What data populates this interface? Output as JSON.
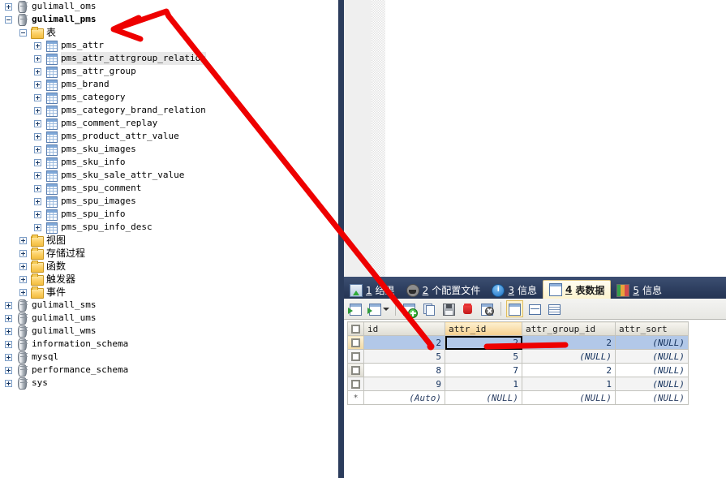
{
  "tree": {
    "items": [
      {
        "label": "gulimall_oms",
        "indent": 0,
        "icon": "database-icon",
        "expander": "plus",
        "bold": false
      },
      {
        "label": "gulimall_pms",
        "indent": 0,
        "icon": "database-icon",
        "expander": "minus",
        "bold": true
      },
      {
        "label": "表",
        "indent": 1,
        "icon": "folder-icon",
        "expander": "minus",
        "bold": false,
        "cjk": true
      },
      {
        "label": "pms_attr",
        "indent": 2,
        "icon": "table-icon",
        "expander": "plus",
        "bold": false
      },
      {
        "label": "pms_attr_attrgroup_relation",
        "indent": 2,
        "icon": "table-icon",
        "expander": "plus",
        "bold": false,
        "highlight": true
      },
      {
        "label": "pms_attr_group",
        "indent": 2,
        "icon": "table-icon",
        "expander": "plus",
        "bold": false
      },
      {
        "label": "pms_brand",
        "indent": 2,
        "icon": "table-icon",
        "expander": "plus",
        "bold": false
      },
      {
        "label": "pms_category",
        "indent": 2,
        "icon": "table-icon",
        "expander": "plus",
        "bold": false
      },
      {
        "label": "pms_category_brand_relation",
        "indent": 2,
        "icon": "table-icon",
        "expander": "plus",
        "bold": false
      },
      {
        "label": "pms_comment_replay",
        "indent": 2,
        "icon": "table-icon",
        "expander": "plus",
        "bold": false
      },
      {
        "label": "pms_product_attr_value",
        "indent": 2,
        "icon": "table-icon",
        "expander": "plus",
        "bold": false
      },
      {
        "label": "pms_sku_images",
        "indent": 2,
        "icon": "table-icon",
        "expander": "plus",
        "bold": false
      },
      {
        "label": "pms_sku_info",
        "indent": 2,
        "icon": "table-icon",
        "expander": "plus",
        "bold": false
      },
      {
        "label": "pms_sku_sale_attr_value",
        "indent": 2,
        "icon": "table-icon",
        "expander": "plus",
        "bold": false
      },
      {
        "label": "pms_spu_comment",
        "indent": 2,
        "icon": "table-icon",
        "expander": "plus",
        "bold": false
      },
      {
        "label": "pms_spu_images",
        "indent": 2,
        "icon": "table-icon",
        "expander": "plus",
        "bold": false
      },
      {
        "label": "pms_spu_info",
        "indent": 2,
        "icon": "table-icon",
        "expander": "plus",
        "bold": false
      },
      {
        "label": "pms_spu_info_desc",
        "indent": 2,
        "icon": "table-icon",
        "expander": "plus",
        "bold": false
      },
      {
        "label": "视图",
        "indent": 1,
        "icon": "folder-icon",
        "expander": "plus",
        "bold": false,
        "cjk": true
      },
      {
        "label": "存储过程",
        "indent": 1,
        "icon": "folder-icon",
        "expander": "plus",
        "bold": false,
        "cjk": true
      },
      {
        "label": "函数",
        "indent": 1,
        "icon": "folder-icon",
        "expander": "plus",
        "bold": false,
        "cjk": true
      },
      {
        "label": "触发器",
        "indent": 1,
        "icon": "folder-icon",
        "expander": "plus",
        "bold": false,
        "cjk": true
      },
      {
        "label": "事件",
        "indent": 1,
        "icon": "folder-icon",
        "expander": "plus",
        "bold": false,
        "cjk": true
      },
      {
        "label": "gulimall_sms",
        "indent": 0,
        "icon": "database-icon",
        "expander": "plus",
        "bold": false
      },
      {
        "label": "gulimall_ums",
        "indent": 0,
        "icon": "database-icon",
        "expander": "plus",
        "bold": false
      },
      {
        "label": "gulimall_wms",
        "indent": 0,
        "icon": "database-icon",
        "expander": "plus",
        "bold": false
      },
      {
        "label": "information_schema",
        "indent": 0,
        "icon": "database-icon",
        "expander": "plus",
        "bold": false
      },
      {
        "label": "mysql",
        "indent": 0,
        "icon": "database-icon",
        "expander": "plus",
        "bold": false
      },
      {
        "label": "performance_schema",
        "indent": 0,
        "icon": "database-icon",
        "expander": "plus",
        "bold": false
      },
      {
        "label": "sys",
        "indent": 0,
        "icon": "database-icon",
        "expander": "plus",
        "bold": false
      }
    ]
  },
  "result_pane": {
    "tabs": [
      {
        "key": "1",
        "label": "结果",
        "icon": "result-grid-icon",
        "active": false
      },
      {
        "key": "2",
        "label": "个配置文件",
        "icon": "profile-icon",
        "active": false
      },
      {
        "key": "3",
        "label": "信息",
        "icon": "info-icon",
        "active": false
      },
      {
        "key": "4",
        "label": "表数据",
        "icon": "table-grid-icon",
        "active": true
      },
      {
        "key": "5",
        "label": "信息",
        "icon": "chart-icon",
        "active": false
      }
    ],
    "toolbar": [
      {
        "name": "apply-changes-icon",
        "type": "grid-arrow"
      },
      {
        "name": "refresh-dropdown-icon",
        "type": "grid-arrow-dd"
      },
      {
        "name": "add-record-icon",
        "type": "add"
      },
      {
        "name": "duplicate-record-icon",
        "type": "copy"
      },
      {
        "name": "save-record-icon",
        "type": "save"
      },
      {
        "name": "delete-record-icon",
        "type": "trash"
      },
      {
        "name": "discard-changes-icon",
        "type": "discard"
      },
      {
        "name": "grid-view-icon",
        "type": "gridview",
        "selected": true
      },
      {
        "name": "form-view-icon",
        "type": "formview",
        "selected": false
      },
      {
        "name": "text-view-icon",
        "type": "textview",
        "selected": false
      }
    ]
  },
  "grid": {
    "columns": [
      "id",
      "attr_id",
      "attr_group_id",
      "attr_sort"
    ],
    "active_column": "attr_id",
    "rows": [
      {
        "cells": [
          "2",
          "2",
          "2",
          "(NULL)"
        ],
        "selected": true,
        "active_cell": 1
      },
      {
        "cells": [
          "5",
          "5",
          "(NULL)",
          "(NULL)"
        ],
        "selected": false
      },
      {
        "cells": [
          "8",
          "7",
          "2",
          "(NULL)"
        ],
        "selected": false
      },
      {
        "cells": [
          "9",
          "1",
          "1",
          "(NULL)"
        ],
        "selected": false
      }
    ],
    "new_row": {
      "marker": "*",
      "cells": [
        "(Auto)",
        "(NULL)",
        "(NULL)",
        "(NULL)"
      ]
    }
  },
  "annotations": {
    "arrow_color": "#ee0000",
    "dot_color": "#ee0000",
    "underline_color": "#ee0000"
  }
}
